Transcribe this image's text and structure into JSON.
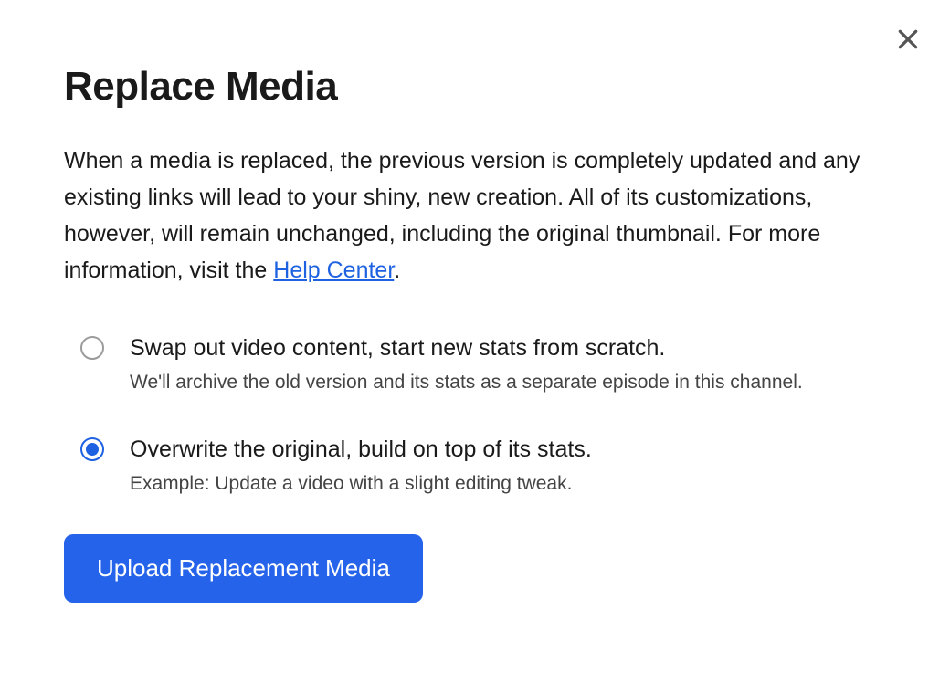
{
  "dialog": {
    "title": "Replace Media",
    "description_pre": "When a media is replaced, the previous version is completely updated and any existing links will lead to your shiny, new creation. All of its customizations, however, will remain unchanged, including the original thumbnail. For more information, visit the ",
    "help_link_text": "Help Center",
    "description_post": ".",
    "options": [
      {
        "label": "Swap out video content, start new stats from scratch.",
        "sub": "We'll archive the old version and its stats as a separate episode in this channel.",
        "selected": false
      },
      {
        "label": "Overwrite the original, build on top of its stats.",
        "sub": "Example: Update a video with a slight editing tweak.",
        "selected": true
      }
    ],
    "upload_button": "Upload Replacement Media"
  }
}
